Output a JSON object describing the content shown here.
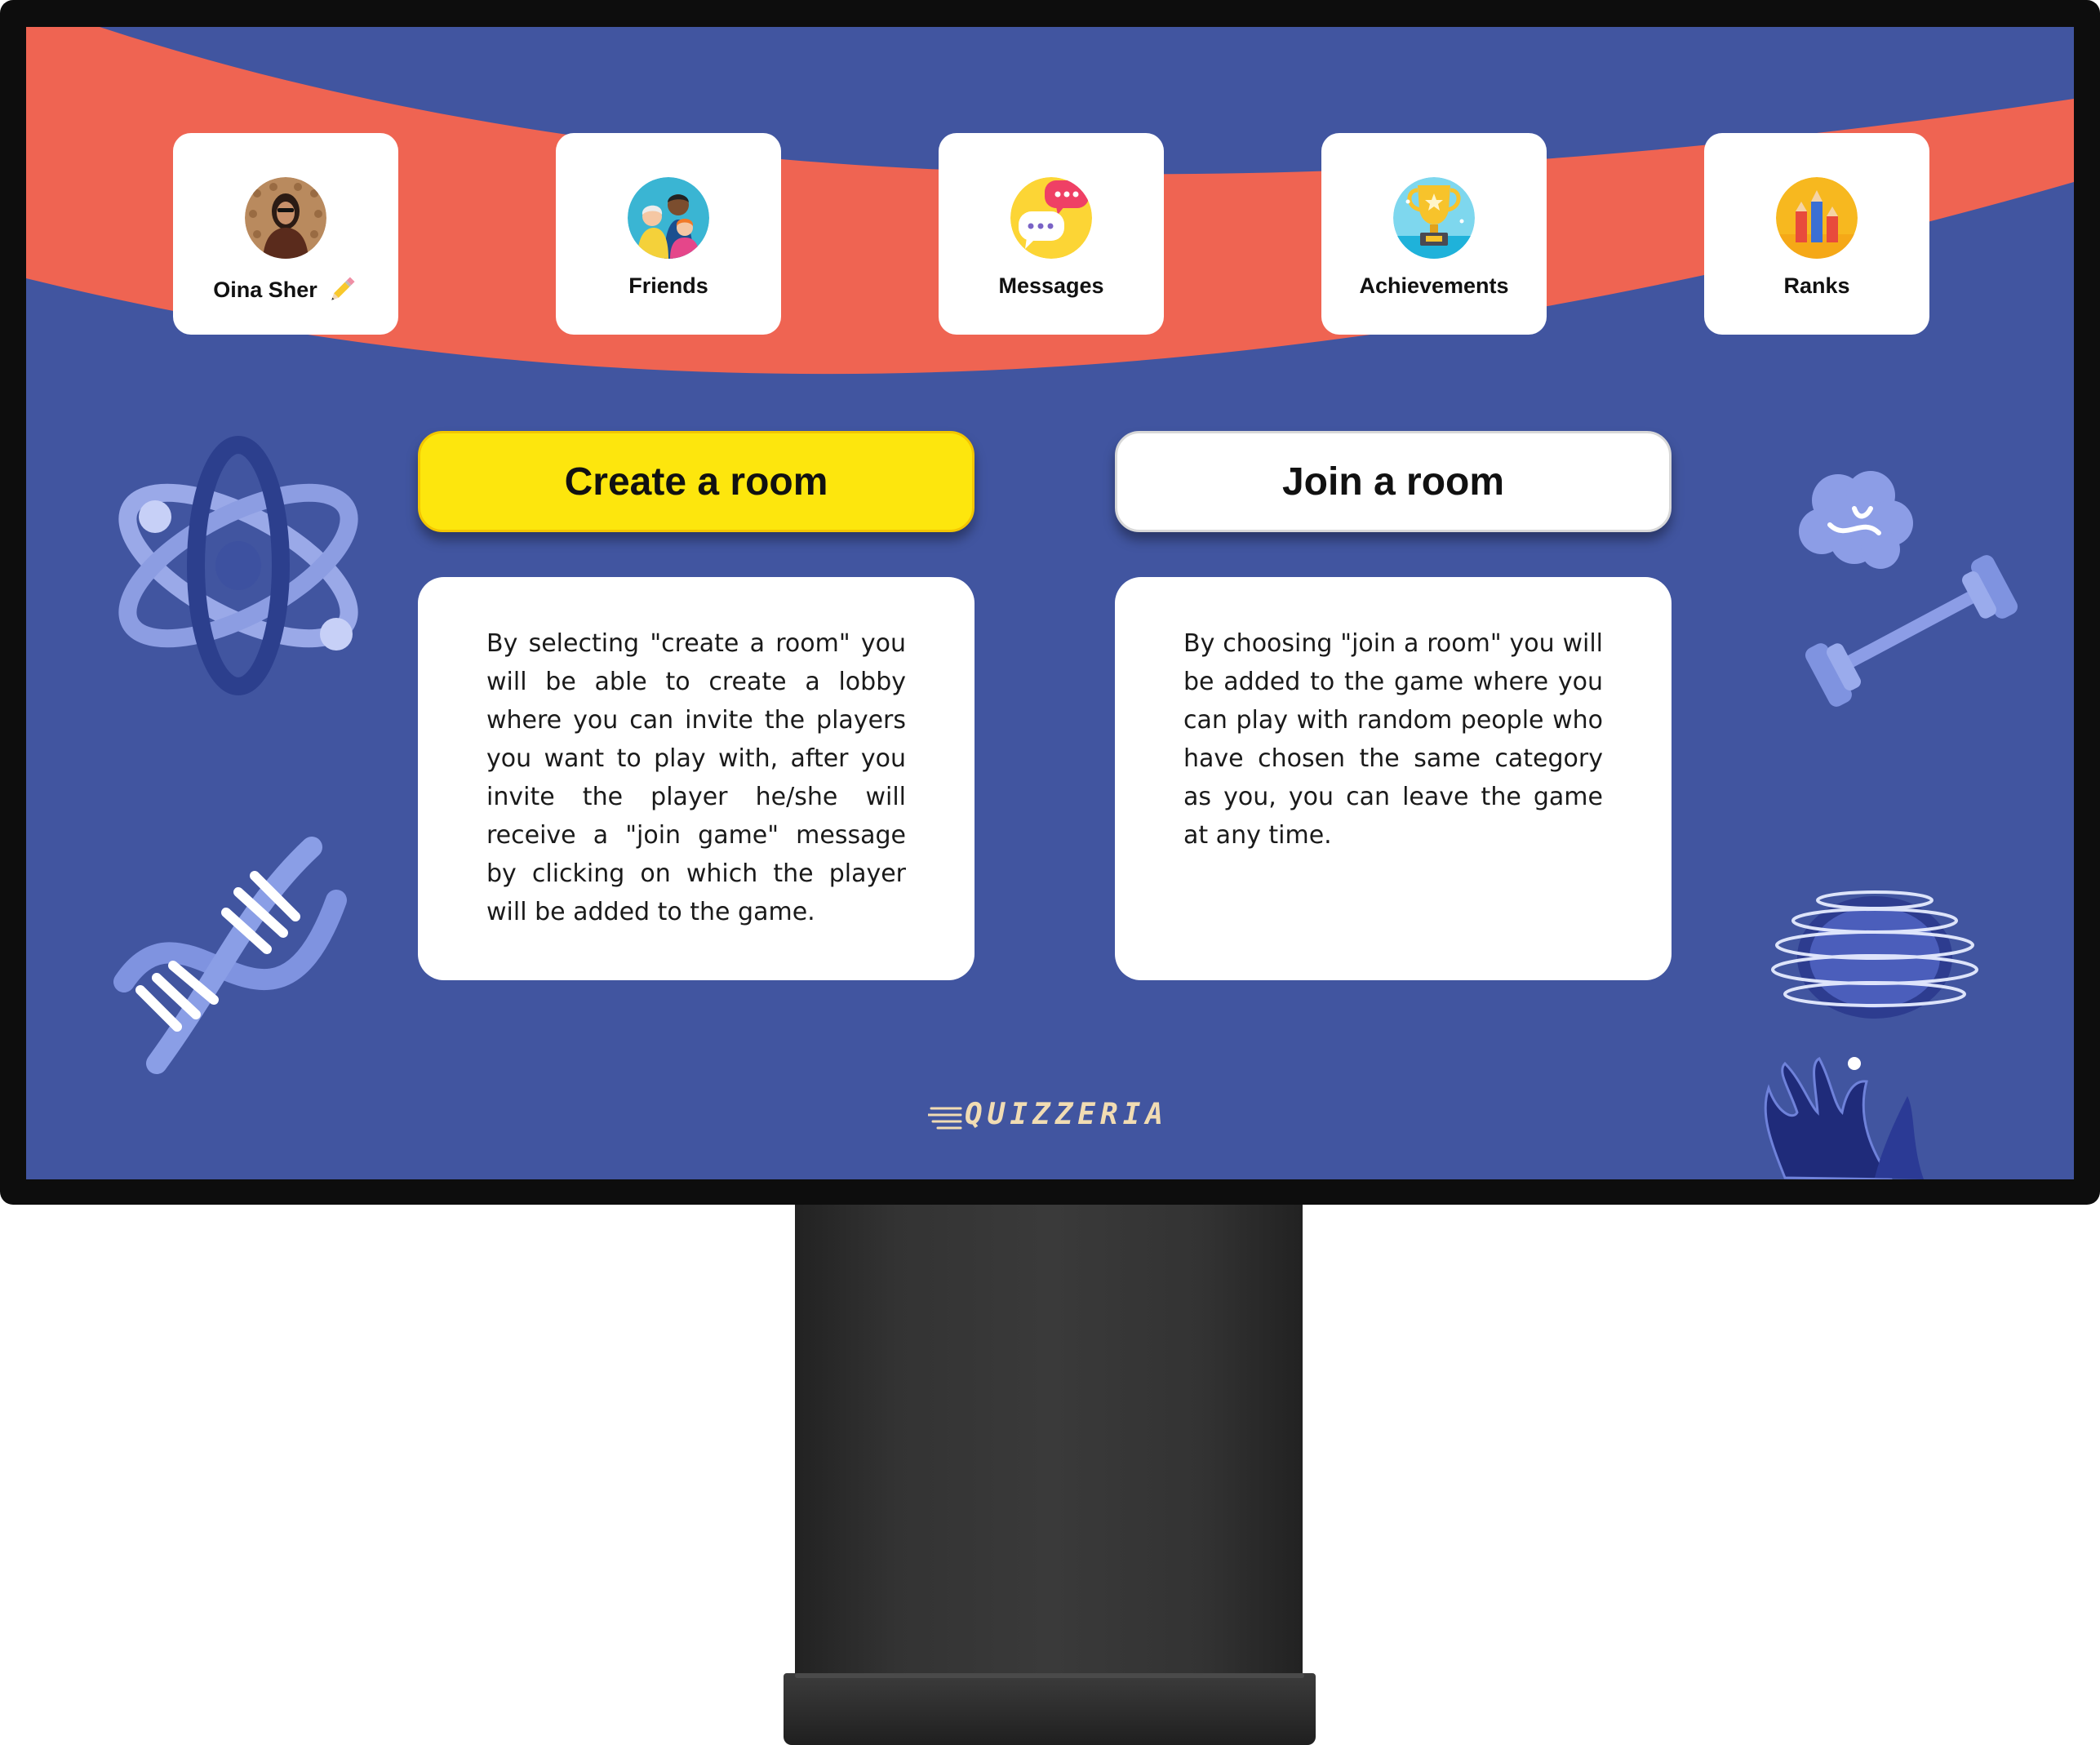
{
  "nav": [
    {
      "key": "profile",
      "label": "Oina Sher",
      "icon": "avatar-photo",
      "editable": true
    },
    {
      "key": "friends",
      "label": "Friends",
      "icon": "friends-icon"
    },
    {
      "key": "messages",
      "label": "Messages",
      "icon": "chat-bubbles-icon"
    },
    {
      "key": "achievements",
      "label": "Achievements",
      "icon": "trophy-icon"
    },
    {
      "key": "ranks",
      "label": "Ranks",
      "icon": "pencils-icon"
    }
  ],
  "actions": {
    "create": {
      "label": "Create a room",
      "description": "By selecting \"create a room\" you will be able to create a lobby where you can invite the players you want to play with, after you invite the player he/she will receive a \"join game\" message by clicking on which the player will be added to the game."
    },
    "join": {
      "label": "Join a room",
      "description": "By choosing \"join a room\" you will be added to the game where you can play with random people who have chosen the same category as you, you can leave the game at any time."
    }
  },
  "brand": {
    "logo_text": "QUIZZERIA"
  },
  "colors": {
    "background": "#4155a0",
    "wave": "#ef6452",
    "create_button": "#fde60d",
    "join_button": "#ffffff"
  }
}
